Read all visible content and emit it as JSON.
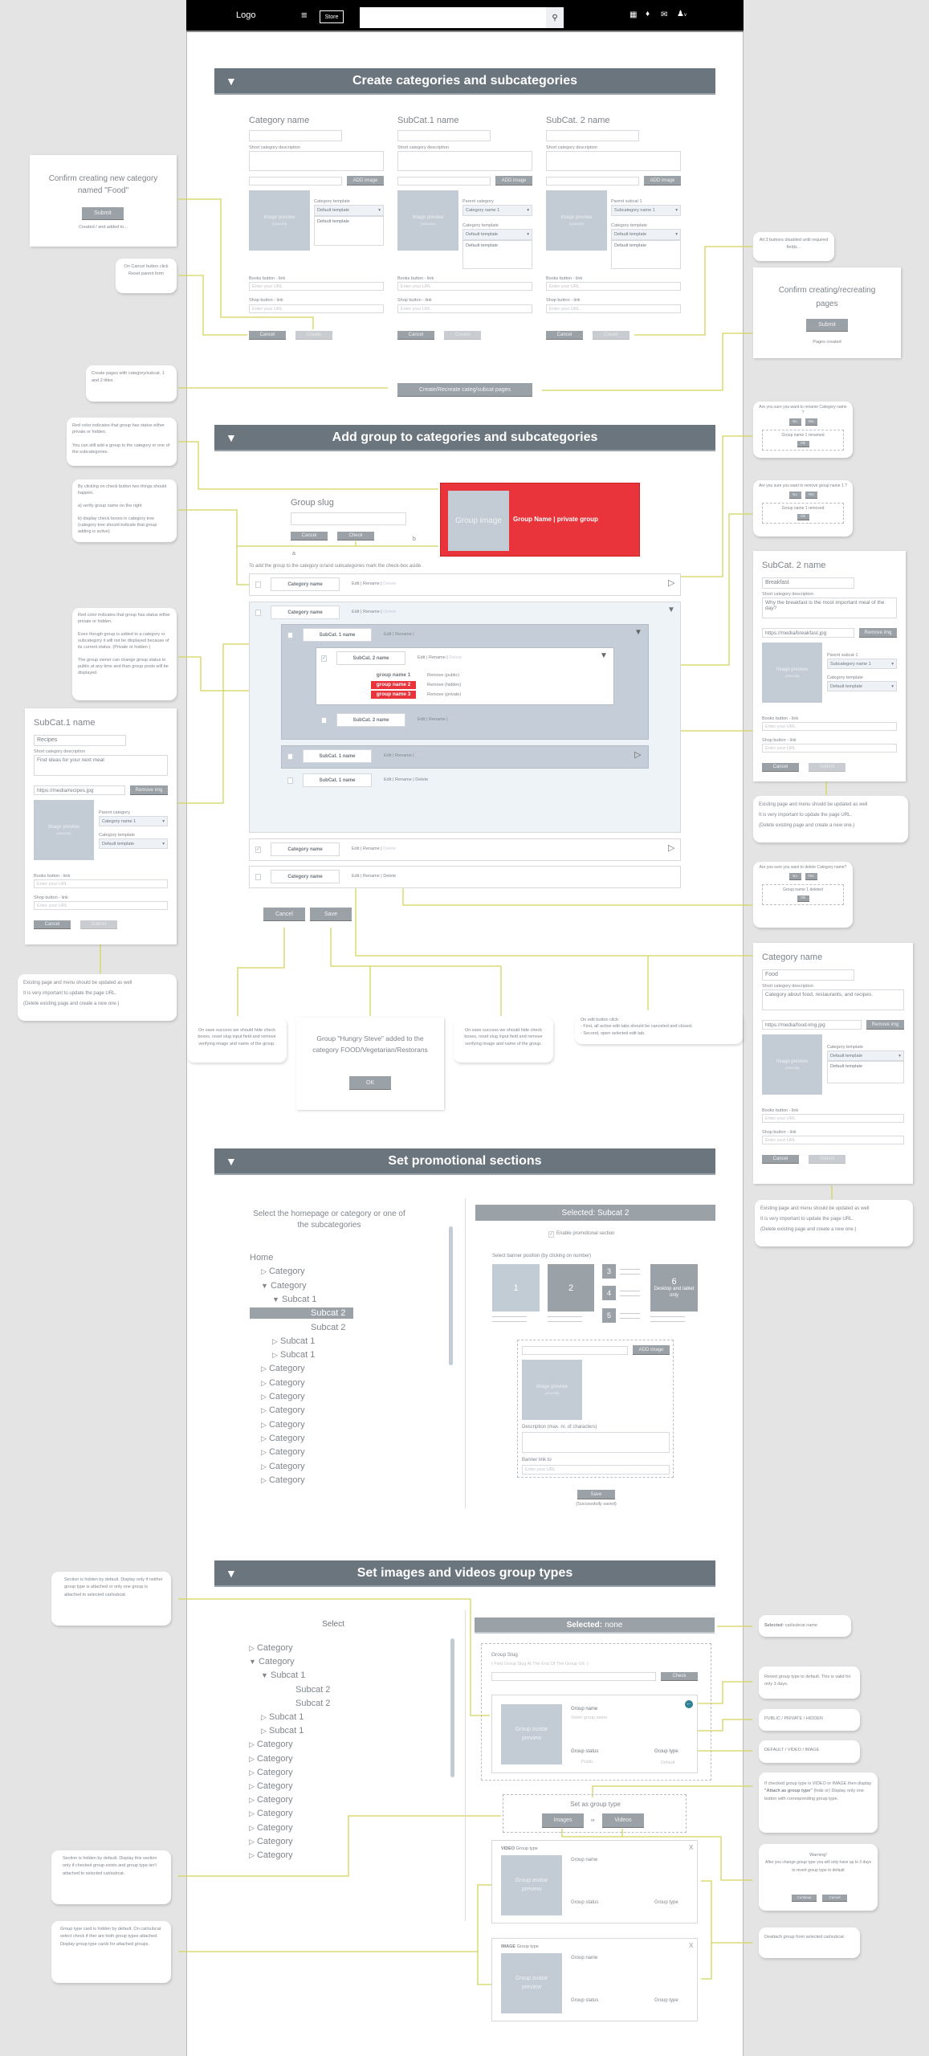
{
  "header": {
    "logo": "Logo",
    "store": "Store",
    "search_value": "",
    "icons": [
      "menu-icon",
      "search-icon",
      "apps-grid-icon",
      "bell-icon",
      "mail-icon",
      "user-icon",
      "chevron-down-icon"
    ]
  },
  "colors": {
    "section_header": "#6b757d",
    "button": "#9aa1a7",
    "preview": "#c3ccd5",
    "private_group": "#e8343a",
    "connector": "#d3d45c",
    "revert_icon": "#2f7f95"
  },
  "create": {
    "title": "Create categories and subcategories",
    "columns": [
      {
        "title": "Category name",
        "desc_label": "Short category description",
        "add_image": "ADD image",
        "preview": "Image preview",
        "preview_size": "(325x325)",
        "select1_label": "Category template",
        "select1_value": "Default template",
        "list_item": "Default template",
        "books_label": "Books button - link",
        "shop_label": "Shop button - link",
        "url_placeholder": "Enter your URL",
        "cancel": "Cancel",
        "create": "Create"
      },
      {
        "title": "SubCat.1 name",
        "desc_label": "Short category description",
        "add_image": "ADD image",
        "preview": "Image preview",
        "preview_size": "(325x325)",
        "select1_label": "Parent category",
        "select1_value": "Category name 1",
        "select2_label": "Category template",
        "select2_value": "Default template",
        "list_item": "Default template",
        "books_label": "Books button - link",
        "shop_label": "Shop button - link",
        "url_placeholder": "Enter your URL",
        "cancel": "Cancel",
        "create": "Create"
      },
      {
        "title": "SubCat. 2 name",
        "desc_label": "Short category description",
        "add_image": "ADD image",
        "preview": "Image preview",
        "preview_size": "(325x325)",
        "select1_label": "Parent subcat 1",
        "select1_value": "Subcategory name 1",
        "select2_label": "Category template",
        "select2_value": "Default template",
        "list_item": "Default template",
        "books_label": "Books button - link",
        "shop_label": "Shop button - link",
        "url_placeholder": "Enter your URL",
        "cancel": "Cancel",
        "create": "Create"
      }
    ],
    "recreate_button": "Create/Recreate categ/subcat pages",
    "confirm_food": {
      "text": "Confirm creating new category named \"Food\"",
      "submit": "Submit",
      "status": "Created / and added to..."
    },
    "confirm_pages": {
      "text": "Confirm creating/recreating pages",
      "submit": "Submit",
      "status": "Pages created"
    },
    "note_cancel": "On Cancel button click Reset parent form",
    "note_create_pages": "Create pages with category/subcat. 1 and 2 titles",
    "note_disabled": "All 3 buttons disabled until required fields..."
  },
  "addgroup": {
    "title": "Add group to categories and subcategories",
    "slug_label": "Group slug",
    "slug_value": "",
    "cancel": "Cancel",
    "check": "Check",
    "marker_a": "a",
    "marker_b": "b",
    "verify": {
      "image": "Group image",
      "name": "Group Name",
      "sep": "|",
      "status": "private group"
    },
    "instruction": "To add the group to the category or/and subcategories mark the check-box aside.",
    "actions": {
      "edit": "Edit",
      "rename": "Rename",
      "delete": "Delete"
    },
    "rows": {
      "category": "Category name",
      "subcat1": "SubCat. 1 name",
      "subcat2": "SubCat. 2 name"
    },
    "groups": [
      {
        "name": "group name 1",
        "remove": "Remove",
        "status": "(public)",
        "private": false
      },
      {
        "name": "group name 2",
        "remove": "Remove",
        "status": "(hidden)",
        "private": true
      },
      {
        "name": "group name 3",
        "remove": "Remove",
        "status": "(private)",
        "private": true
      }
    ],
    "cancel_btn": "Cancel",
    "save_btn": "Save",
    "note_red1": "Red color indicates that group has status either private or hidden.\n\nYou can still add a group to the category or one of the subcategories.",
    "note_check": "By clicking on check button two things should happen.\n\na) verify group name on the right\n\nb) display check boxes in category tree (category tree should indicate that group adding is active)",
    "note_red2": "Red color indicates that group has status either private or hidden.\n\nEven though group is added to a category or subcategory it will not be displayed because of its current status. (Private or hidden )\n\nThe group owner can change group status to public at any time and than group posts will be displayed.",
    "rename_dialog": {
      "question": "Are you sure you want to rename Category name ?",
      "no": "No",
      "yes": "Yes",
      "result": "Group name 1 renamed",
      "ok": "Ok"
    },
    "remove_dialog": {
      "question": "Are you sure you want to remove group name 1 ?",
      "no": "No",
      "yes": "Yes",
      "result": "Group name 1 removed",
      "ok": "Ok"
    },
    "delete_dialog": {
      "question": "Are you sure you want to delete Category name?",
      "no": "No",
      "yes": "Yes",
      "result": "Group name 1 deleted",
      "ok": "Ok"
    },
    "subcat1_card": {
      "title": "SubCat.1 name",
      "name_value": "Recipes",
      "desc_label": "Short category description",
      "desc_value": "Find ideas for your next meal",
      "img_url": "https://media/recipes.jpg",
      "remove_img": "Remove img",
      "preview": "Image preview",
      "preview_size": "(325x325)",
      "select1_label": "Parent category",
      "select1_value": "Category name 1",
      "select2_label": "Category template",
      "select2_value": "Default template",
      "books_label": "Books button - link",
      "shop_label": "Shop button - link",
      "url_placeholder": "Enter your URL",
      "cancel": "Cancel",
      "submit": "Submit"
    },
    "subcat2_card": {
      "title": "SubCat. 2 name",
      "name_value": "Breakfast",
      "desc_label": "Short category description",
      "desc_value": "Why the breakfast is the most important meal of the day?",
      "img_url": "https://media/breakfast.jpg",
      "remove_img": "Remove img",
      "preview": "Image preview",
      "preview_size": "(325x325)",
      "select1_label": "Parent subcat 1",
      "select1_value": "Subcategory name 1",
      "select2_label": "Category template",
      "select2_value": "Default template",
      "books_label": "Books button - link",
      "shop_label": "Shop button - link",
      "url_placeholder": "Enter your URL",
      "cancel": "Cancel",
      "submit": "Submit"
    },
    "category_card": {
      "title": "Category name",
      "name_value": "Food",
      "desc_label": "Short category description",
      "desc_value": "Category about food, restaurants, and recipes.",
      "img_url": "https://media/food-img.jpg",
      "remove_img": "Remove img",
      "preview": "Image preview",
      "preview_size": "(325x325)",
      "select1_label": "Category template",
      "select1_value": "Default template",
      "list_item": "Default template",
      "books_label": "Books button - link",
      "shop_label": "Shop button - link",
      "url_placeholder": "Enter your URL",
      "cancel": "Cancel",
      "submit": "Submit"
    },
    "note_update": [
      "Existing page and menu should be updated as well",
      "It is very important to update the page URL.",
      "(Delete existing page and create a new one.)"
    ],
    "note_save": "On save success we should hide check boxes, reset slug input field and remove verifying image and name of the group.",
    "added_dialog": {
      "text": "Group \"Hungry Steve\" added to the category FOOD/Vegetarian/Restorans",
      "ok": "OK"
    },
    "note_edit": "On edit button click:\n- First, all active edit tabs should be canceled and closed.\n- Second, open selected edit tab."
  },
  "promo": {
    "title": "Set promotional sections",
    "select_text": "Select the homepage or category or one of the subcategories",
    "tree": [
      {
        "label": "Home",
        "level": 0,
        "icon": "none"
      },
      {
        "label": "Category",
        "level": 1,
        "icon": "collapsed"
      },
      {
        "label": "Category",
        "level": 1,
        "icon": "expanded"
      },
      {
        "label": "Subcat 1",
        "level": 2,
        "icon": "expanded"
      },
      {
        "label": "Subcat 2",
        "level": 3,
        "icon": "none",
        "selected": true
      },
      {
        "label": "Subcat 2",
        "level": 3,
        "icon": "none"
      },
      {
        "label": "Subcat 1",
        "level": 2,
        "icon": "collapsed"
      },
      {
        "label": "Subcat 1",
        "level": 2,
        "icon": "collapsed"
      },
      {
        "label": "Category",
        "level": 1,
        "icon": "collapsed"
      },
      {
        "label": "Category",
        "level": 1,
        "icon": "collapsed"
      },
      {
        "label": "Category",
        "level": 1,
        "icon": "collapsed"
      },
      {
        "label": "Category",
        "level": 1,
        "icon": "collapsed"
      },
      {
        "label": "Category",
        "level": 1,
        "icon": "collapsed"
      },
      {
        "label": "Category",
        "level": 1,
        "icon": "collapsed"
      },
      {
        "label": "Category",
        "level": 1,
        "icon": "collapsed"
      },
      {
        "label": "Category",
        "level": 1,
        "icon": "collapsed"
      },
      {
        "label": "Category",
        "level": 1,
        "icon": "collapsed"
      }
    ],
    "selected": "Selected: Subcat 2",
    "enable_label": "Enable promotional section",
    "enable_checked": true,
    "banner_label": "Select banner position (by clicking on number)",
    "positions": [
      "1",
      "2",
      "3",
      "4",
      "5",
      "6"
    ],
    "position6_note": "Desktop and tablet only",
    "selected_position": "2",
    "add_image": "ADD image",
    "preview": "Image preview",
    "preview_size": "(325x325)",
    "desc_label": "Description (max. nr. of characters)",
    "link_label": "Banner link to",
    "url_placeholder": "Enter your URL",
    "save": "Save",
    "saved": "(Successfully saved)"
  },
  "types": {
    "title": "Set images and videos group types",
    "select_text": "Select",
    "tree": [
      {
        "label": "Category",
        "level": 1,
        "icon": "collapsed"
      },
      {
        "label": "Category",
        "level": 1,
        "icon": "expanded"
      },
      {
        "label": "Subcat 1",
        "level": 2,
        "icon": "expanded"
      },
      {
        "label": "Subcat 2",
        "level": 3,
        "icon": "none"
      },
      {
        "label": "Subcat 2",
        "level": 3,
        "icon": "none"
      },
      {
        "label": "Subcat 1",
        "level": 2,
        "icon": "collapsed"
      },
      {
        "label": "Subcat 1",
        "level": 2,
        "icon": "collapsed"
      },
      {
        "label": "Category",
        "level": 1,
        "icon": "collapsed"
      },
      {
        "label": "Category",
        "level": 1,
        "icon": "collapsed"
      },
      {
        "label": "Category",
        "level": 1,
        "icon": "collapsed"
      },
      {
        "label": "Category",
        "level": 1,
        "icon": "collapsed"
      },
      {
        "label": "Category",
        "level": 1,
        "icon": "collapsed"
      },
      {
        "label": "Category",
        "level": 1,
        "icon": "collapsed"
      },
      {
        "label": "Category",
        "level": 1,
        "icon": "collapsed"
      },
      {
        "label": "Category",
        "level": 1,
        "icon": "collapsed"
      },
      {
        "label": "Category",
        "level": 1,
        "icon": "collapsed"
      }
    ],
    "selected_prefix": "Selected:",
    "selected_value": "none",
    "slug_label": "Group Slug",
    "slug_placeholder": "( Find Group Slug At The End Of The Group Url. )",
    "check": "Check",
    "group": {
      "avatar": "Group avatar preview",
      "name_label": "Group name",
      "name_value": "Some group name",
      "status_label": "Group status",
      "status_value": "Public",
      "type_label": "Group type",
      "type_value": "Default"
    },
    "set_as": "Set as group type",
    "images": "Images",
    "or": "or",
    "videos": "Videos",
    "video_card": {
      "label_strong": "VIDEO",
      "label": "Group type",
      "avatar": "Group avatar preview",
      "name_label": "Group name",
      "status_label": "Group status",
      "type_label": "Group type",
      "close": "X"
    },
    "image_card": {
      "label_strong": "IMAGE",
      "label": "Group type",
      "avatar": "Group avatar preview",
      "name_label": "Group name",
      "status_label": "Group status",
      "type_label": "Group type",
      "close": "X"
    },
    "note_hidden1": "Section is hidden by default. Display only if neither group type is attached or only one group is attached to selected cat/subcat.",
    "note_hidden2": "Section is hidden by default. Display this section only if checked group exists and group type isn't attached to selected cat/subcat.",
    "note_cards": "Group type card is hidden by default. On cat/subcat select check if ther are both group types attached. Display group type cards for attached groups.",
    "note_selected_strong": "Selected",
    "note_selected": ": cat/subcat name",
    "note_revert": "Revert group type to default. This is valid for only 3 days.",
    "note_status": "PUBLIC / PRIVATE / HIDDEN",
    "note_type": "DEFAULT / VIDEO / IMAGE",
    "note_attach_1": "If checked group type is VIDEO or IMAGE then display",
    "note_attach_strong": "\"Attach as group type\"",
    "note_attach_2": "(hide or) Display only one button with corresponding group type.",
    "warning": {
      "title": "Warning!",
      "text": "After you change group type you will only have up to 3 days to revert group type to default",
      "continue": "Continue",
      "cancel": "Cancel"
    },
    "note_deattach": "Deattach group from selected cat/subcat."
  }
}
